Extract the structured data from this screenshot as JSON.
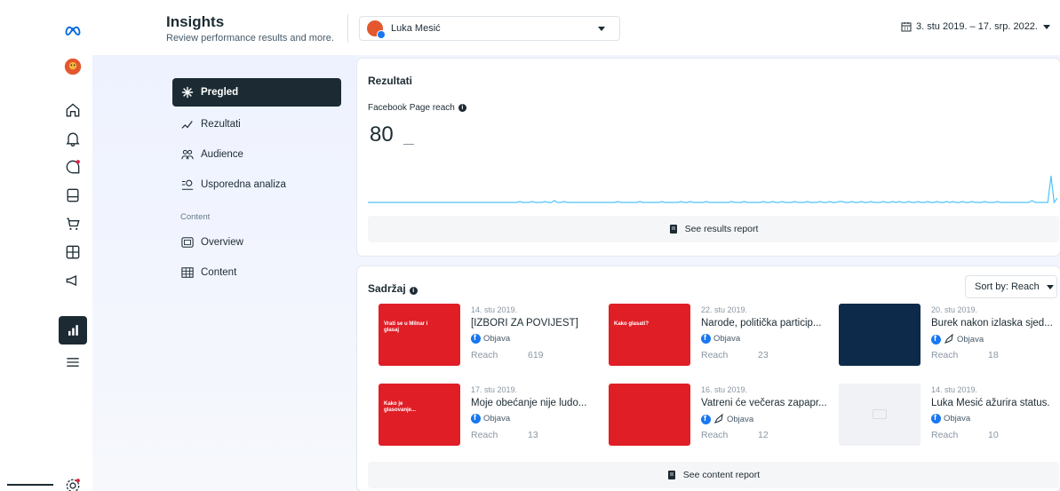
{
  "brand": {
    "logo_icon": "meta-logo-icon"
  },
  "rail": {
    "items": [
      {
        "name": "avatar",
        "icon": "profile-avatar"
      },
      {
        "name": "home",
        "icon": "home-icon"
      },
      {
        "name": "notifications",
        "icon": "bell-icon"
      },
      {
        "name": "inbox",
        "icon": "chat-icon"
      },
      {
        "name": "posts",
        "icon": "posts-icon"
      },
      {
        "name": "commerce",
        "icon": "cart-icon"
      },
      {
        "name": "tools",
        "icon": "grid-icon"
      },
      {
        "name": "ads",
        "icon": "megaphone-icon"
      },
      {
        "name": "insights",
        "icon": "insights-icon",
        "active": true
      },
      {
        "name": "menu",
        "icon": "menu-icon"
      },
      {
        "name": "settings",
        "icon": "gear-icon"
      }
    ]
  },
  "header": {
    "title": "Insights",
    "subtitle": "Review performance results and more.",
    "account_name": "Luka Mesić",
    "date_range": "3. stu 2019. – 17. srp. 2022."
  },
  "sidenav": {
    "items": [
      {
        "label": "Pregled",
        "icon": "sparkle-icon",
        "active": true
      },
      {
        "label": "Rezultati",
        "icon": "trend-icon"
      },
      {
        "label": "Audience",
        "icon": "people-icon"
      },
      {
        "label": "Usporedna analiza",
        "icon": "compare-icon"
      }
    ],
    "section_label": "Content",
    "content_items": [
      {
        "label": "Overview",
        "icon": "overview-icon"
      },
      {
        "label": "Content",
        "icon": "table-icon"
      }
    ]
  },
  "results": {
    "title": "Rezultati",
    "metric_label": "Facebook Page reach",
    "metric_value": "80",
    "report_button": "See results report"
  },
  "content": {
    "title": "Sadržaj",
    "sort_label": "Sort by: Reach",
    "reach_label": "Reach",
    "report_button": "See content report",
    "posts": [
      {
        "date": "14. stu 2019.",
        "title": "[IZBORI ZA POVIJEST]",
        "type": "Objava",
        "boosted": false,
        "reach": "619",
        "thumb_text": "Vrati se u Milnar i glasaj",
        "thumb_color": "#e01e26"
      },
      {
        "date": "22. stu 2019.",
        "title": "Narode, politička particip...",
        "type": "Objava",
        "boosted": false,
        "reach": "23",
        "thumb_text": "Kako glasati?",
        "thumb_color": "#e01e26"
      },
      {
        "date": "20. stu 2019.",
        "title": "Burek nakon izlaska sjed...",
        "type": "Objava",
        "boosted": true,
        "reach": "18",
        "thumb_text": "",
        "thumb_color": "#0d2a4a"
      },
      {
        "date": "17. stu 2019.",
        "title": "Moje obećanje nije ludo...",
        "type": "Objava",
        "boosted": false,
        "reach": "13",
        "thumb_text": "Kako je glasovanje...",
        "thumb_color": "#e01e26"
      },
      {
        "date": "16. stu 2019.",
        "title": "Vatreni će večeras zapapr...",
        "type": "Objava",
        "boosted": true,
        "reach": "12",
        "thumb_text": "",
        "thumb_color": "#e01e26"
      },
      {
        "date": "14. stu 2019.",
        "title": "Luka Mesić ažurira status.",
        "type": "Objava",
        "boosted": false,
        "reach": "10",
        "thumb_text": "",
        "thumb_color": "#f0f2f5"
      }
    ]
  },
  "chart_data": {
    "type": "line",
    "title": "Facebook Page reach",
    "color": "#4fc3f7",
    "values": [
      0,
      0,
      0,
      0,
      0,
      0,
      0,
      0,
      0,
      0,
      0,
      0,
      0,
      0,
      0,
      0,
      0,
      0,
      0,
      0,
      0,
      0,
      0,
      0,
      0,
      0,
      0,
      0,
      0,
      0,
      0,
      0,
      0,
      0,
      0,
      0,
      0,
      0,
      0,
      0,
      0,
      0,
      0,
      0,
      0,
      0,
      0,
      0,
      1,
      0,
      0,
      0,
      1,
      0,
      0,
      0,
      1,
      0,
      0,
      2,
      0,
      0,
      1,
      0,
      0,
      0,
      0,
      0,
      0,
      0,
      0,
      0,
      0,
      0,
      0,
      0,
      0,
      0,
      0,
      1,
      0,
      0,
      0,
      0,
      0,
      0,
      1,
      0,
      0,
      0,
      0,
      0,
      0,
      1,
      0,
      0,
      0,
      0,
      0,
      1,
      0,
      0,
      1,
      0,
      0,
      0,
      0,
      1,
      0,
      0,
      0,
      0,
      0,
      0,
      0,
      1,
      0,
      0,
      0,
      1,
      0,
      0,
      0,
      0,
      0,
      1,
      0,
      0,
      1,
      0,
      0,
      1,
      0,
      0,
      0,
      1,
      0,
      0,
      0,
      1,
      0,
      0,
      0,
      1,
      0,
      0,
      1,
      0,
      0,
      1,
      1,
      0,
      0,
      1,
      0,
      0,
      1,
      0,
      0,
      1,
      0,
      0,
      0,
      1,
      0,
      0,
      1,
      0,
      1,
      0,
      0,
      1,
      0,
      0,
      1,
      0,
      0,
      1,
      0,
      0,
      1,
      0,
      0,
      1,
      0,
      1,
      0,
      0,
      1,
      0,
      0,
      1,
      0,
      0,
      0,
      1,
      0,
      0,
      0,
      1,
      0,
      0,
      0,
      0,
      0,
      0,
      0,
      0,
      0,
      0,
      2,
      0,
      0,
      0,
      0,
      0,
      30,
      0,
      5
    ]
  }
}
